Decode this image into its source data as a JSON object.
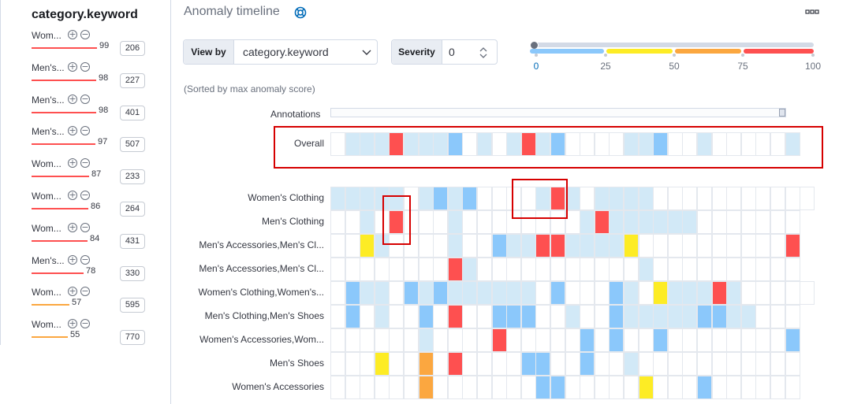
{
  "left_panel": {
    "title": "category.keyword",
    "influencers": [
      {
        "name": "Wom...",
        "score": "99",
        "count": "206",
        "level": "critical",
        "fraction": 0.99
      },
      {
        "name": "Men's...",
        "score": "98",
        "count": "227",
        "level": "critical",
        "fraction": 0.98
      },
      {
        "name": "Men's...",
        "score": "98",
        "count": "401",
        "level": "critical",
        "fraction": 0.98
      },
      {
        "name": "Men's...",
        "score": "97",
        "count": "507",
        "level": "critical",
        "fraction": 0.97
      },
      {
        "name": "Wom...",
        "score": "87",
        "count": "233",
        "level": "critical",
        "fraction": 0.87
      },
      {
        "name": "Wom...",
        "score": "86",
        "count": "264",
        "level": "critical",
        "fraction": 0.86
      },
      {
        "name": "Wom...",
        "score": "84",
        "count": "431",
        "level": "critical",
        "fraction": 0.84
      },
      {
        "name": "Men's...",
        "score": "78",
        "count": "330",
        "level": "critical",
        "fraction": 0.78
      },
      {
        "name": "Wom...",
        "score": "57",
        "count": "595",
        "level": "major",
        "fraction": 0.57
      },
      {
        "name": "Wom...",
        "score": "55",
        "count": "770",
        "level": "major",
        "fraction": 0.55
      }
    ]
  },
  "header": {
    "title": "Anomaly timeline",
    "help_icon": "life-ring-icon",
    "menu_icon": "ellipsis-icon"
  },
  "controls": {
    "view_by_label": "View by",
    "view_by_value": "category.keyword",
    "severity_label": "Severity",
    "severity_value": "0"
  },
  "severity_slider": {
    "value": 0,
    "ticks": [
      "0",
      "25",
      "50",
      "75",
      "100"
    ]
  },
  "sort_note": "(Sorted by max anomaly score)",
  "annotations_label": "Annotations",
  "overall": {
    "label": "Overall",
    "cells": [
      "",
      "l",
      "l",
      "l",
      "r",
      "l",
      "l",
      "l",
      "b",
      "",
      "l",
      "",
      "l",
      "r",
      "l",
      "b",
      "",
      "",
      "",
      "",
      "l",
      "l",
      "b",
      "",
      "",
      "l",
      "",
      "",
      "",
      "",
      "",
      "l"
    ]
  },
  "lanes": [
    {
      "label": "Women's Clothing",
      "cells": [
        "l",
        "l",
        "l",
        "l",
        "l",
        "",
        "l",
        "b",
        "l",
        "b",
        "",
        "",
        "",
        "",
        "l",
        "r",
        "l",
        "",
        "l",
        "l",
        "l",
        "l",
        "",
        "",
        "",
        "",
        "",
        "",
        "",
        "",
        "",
        "",
        ""
      ]
    },
    {
      "label": "Men's Clothing",
      "cells": [
        "",
        "",
        "l",
        "",
        "r",
        "",
        "",
        "",
        "l",
        "",
        "",
        "",
        "",
        "",
        "",
        "",
        "",
        "l",
        "r",
        "l",
        "l",
        "l",
        "l",
        "l",
        "l",
        "",
        "",
        "",
        "",
        "",
        "",
        ""
      ]
    },
    {
      "label": "Men's Accessories,Men's Cl...",
      "cells": [
        "",
        "",
        "y",
        "l",
        "",
        "",
        "",
        "",
        "l",
        "",
        "",
        "b",
        "l",
        "l",
        "r",
        "r",
        "l",
        "l",
        "l",
        "l",
        "y",
        "",
        "",
        "",
        "",
        "",
        "",
        "",
        "",
        "",
        "",
        "r"
      ]
    },
    {
      "label": "Men's Accessories,Men's Cl...",
      "cells": [
        "",
        "",
        "",
        "",
        "",
        "",
        "",
        "",
        "r",
        "l",
        "",
        "",
        "",
        "",
        "",
        "",
        "",
        "",
        "",
        "",
        "",
        "l",
        "",
        "",
        "",
        "",
        "",
        "",
        "",
        "",
        "",
        ""
      ]
    },
    {
      "label": "Women's Clothing,Women's...",
      "cells": [
        "",
        "b",
        "l",
        "l",
        "",
        "b",
        "l",
        "b",
        "l",
        "l",
        "l",
        "l",
        "l",
        "l",
        "",
        "b",
        "",
        "",
        "",
        "b",
        "l",
        "",
        "y",
        "l",
        "l",
        "l",
        "r",
        "l",
        "",
        "",
        "",
        "",
        ""
      ]
    },
    {
      "label": "Men's Clothing,Men's Shoes",
      "cells": [
        "",
        "b",
        "",
        "l",
        "",
        "",
        "b",
        "",
        "r",
        "",
        "",
        "b",
        "b",
        "b",
        "",
        "",
        "l",
        "",
        "",
        "b",
        "l",
        "l",
        "l",
        "l",
        "l",
        "b",
        "b",
        "l",
        "l",
        "",
        "",
        ""
      ]
    },
    {
      "label": "Women's Accessories,Wom...",
      "cells": [
        "",
        "",
        "",
        "",
        "",
        "",
        "l",
        "",
        "",
        "",
        "",
        "r",
        "",
        "",
        "",
        "",
        "",
        "b",
        "",
        "b",
        "",
        "",
        "b",
        "",
        "",
        "",
        "",
        "",
        "",
        "",
        "",
        "b"
      ]
    },
    {
      "label": "Men's Shoes",
      "cells": [
        "",
        "",
        "",
        "y",
        "",
        "",
        "o",
        "",
        "r",
        "",
        "",
        "",
        "",
        "b",
        "b",
        "",
        "",
        "b",
        "",
        "",
        "l",
        "",
        "",
        "",
        "",
        "",
        "",
        "",
        "",
        "",
        "",
        ""
      ]
    },
    {
      "label": "Women's Accessories",
      "cells": [
        "",
        "",
        "",
        "",
        "",
        "",
        "o",
        "",
        "",
        "",
        "",
        "",
        "",
        "",
        "b",
        "b",
        "",
        "",
        "",
        "",
        "",
        "y",
        "",
        "",
        "",
        "b",
        "",
        "",
        "",
        "",
        "",
        ""
      ]
    }
  ],
  "colors": {
    "l": "#d2e9f7",
    "b": "#8bc8fb",
    "y": "#fdec25",
    "o": "#fba740",
    "r": "#fe5050",
    "band_blue": "#8bc8fb",
    "band_yellow": "#fdec25",
    "band_orange": "#fba740",
    "band_red": "#fe5050",
    "highlight": "#d60000"
  }
}
